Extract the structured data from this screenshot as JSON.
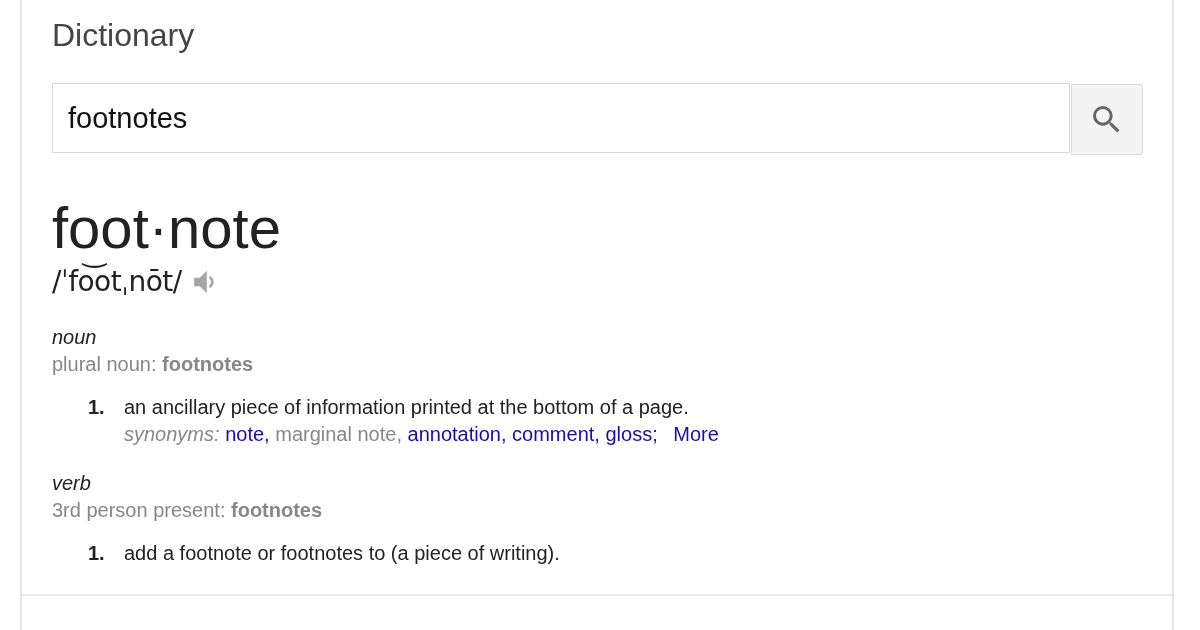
{
  "panel": {
    "title": "Dictionary",
    "search": {
      "value": "footnotes"
    }
  },
  "entry": {
    "headword": "foot·note",
    "pronunciation": "/ˈfo͝otˌnōt/"
  },
  "senses": [
    {
      "part_of_speech": "noun",
      "inflection": "plural noun: **footnotes**",
      "definitions": [
        {
          "number": "1.",
          "text": "an ancillary piece of information printed at the bottom of a page.",
          "synonyms_label": "synonyms:",
          "synonyms": [
            {
              "text": "note",
              "kind": "link",
              "separator": ","
            },
            {
              "text": "marginal note",
              "kind": "plain",
              "separator": ","
            },
            {
              "text": "annotation",
              "kind": "link",
              "separator": ","
            },
            {
              "text": "comment",
              "kind": "link",
              "separator": ","
            },
            {
              "text": "gloss",
              "kind": "link",
              "separator": ";"
            }
          ],
          "more": "More"
        }
      ]
    },
    {
      "part_of_speech": "verb",
      "inflection": "3rd person present: **footnotes**",
      "definitions": [
        {
          "number": "1.",
          "text": "add a footnote or footnotes to (a piece of writing)."
        }
      ]
    }
  ]
}
